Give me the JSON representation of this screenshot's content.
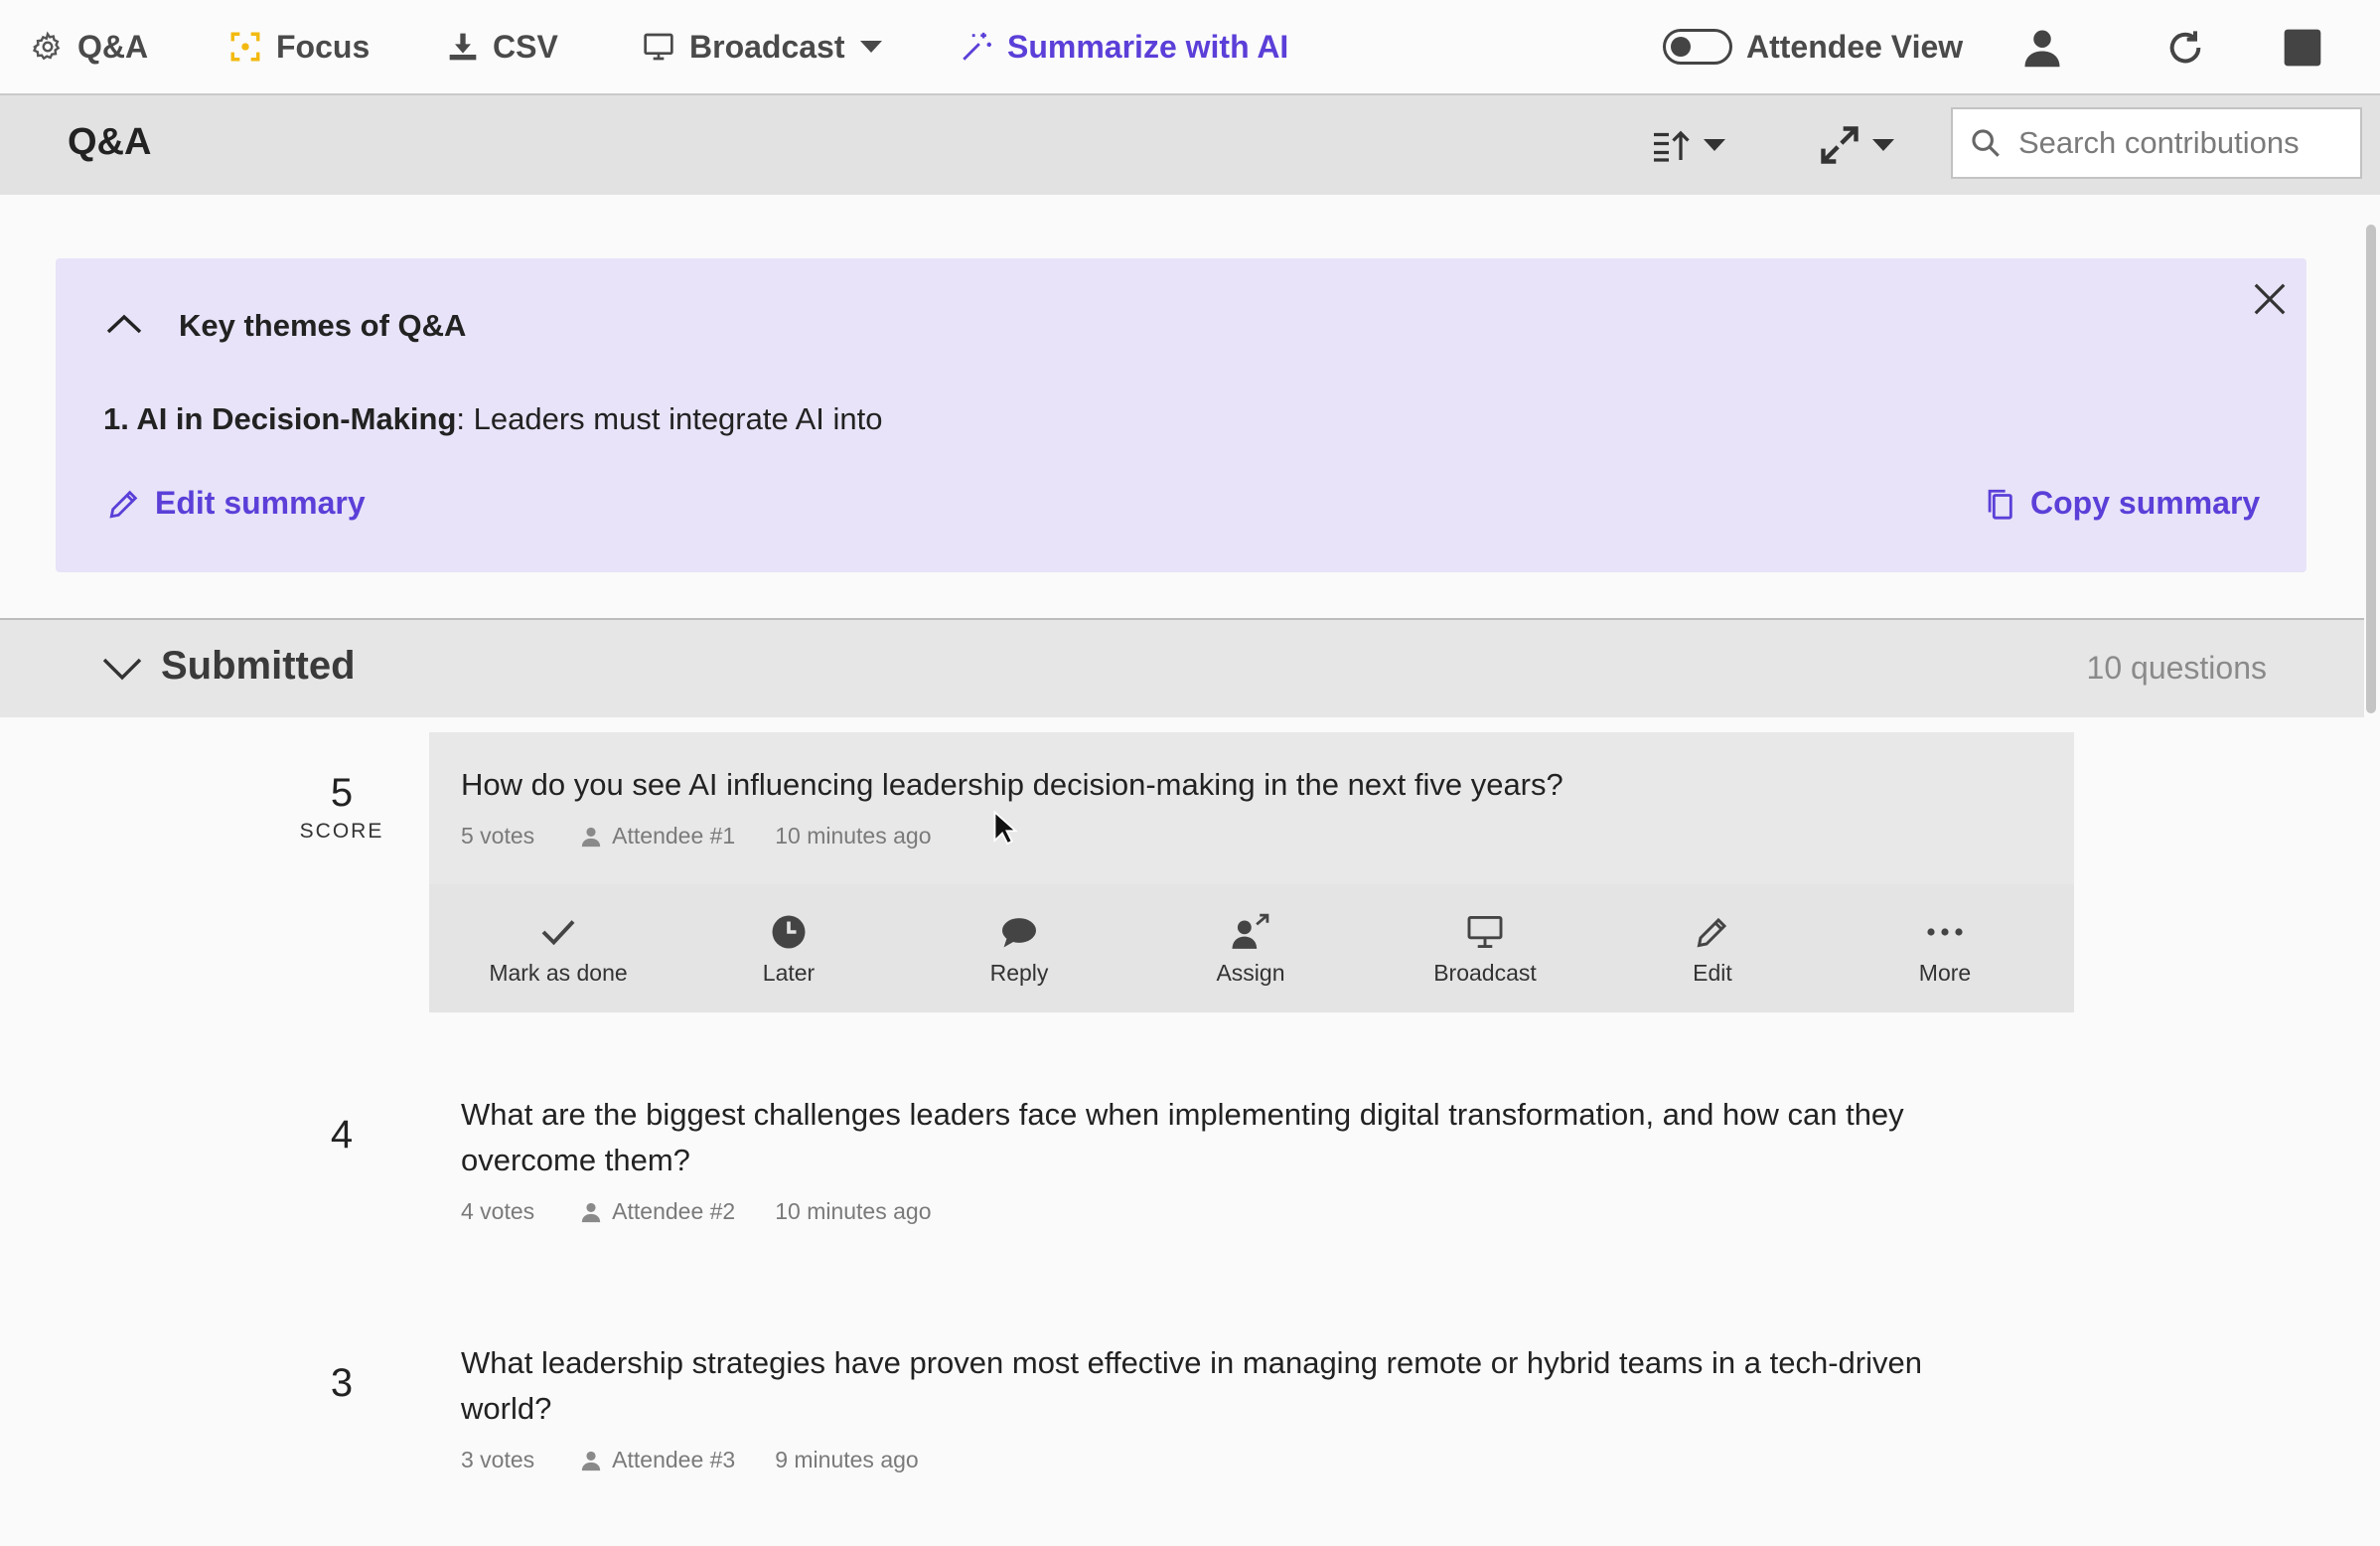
{
  "toolbar": {
    "qa_label": "Q&A",
    "focus_label": "Focus",
    "csv_label": "CSV",
    "broadcast_label": "Broadcast",
    "summarize_label": "Summarize with AI",
    "attendee_view_label": "Attendee View",
    "attendee_view_on": false
  },
  "header": {
    "title": "Q&A",
    "search_placeholder": "Search contributions"
  },
  "summary": {
    "title": "Key themes of Q&A",
    "theme_heading": "1. AI in Decision-Making",
    "theme_text": ": Leaders must integrate AI into",
    "edit_label": "Edit summary",
    "copy_label": "Copy summary"
  },
  "section": {
    "title": "Submitted",
    "count": "10 questions"
  },
  "questions": [
    {
      "score": "5",
      "score_label": "SCORE",
      "text": "How do you see AI influencing leadership decision-making in the next five years?",
      "votes": "5 votes",
      "author": "Attendee #1",
      "time": "10 minutes ago"
    },
    {
      "score": "4",
      "text": "What are the biggest challenges leaders face when implementing digital transformation, and how can they overcome them?",
      "votes": "4 votes",
      "author": "Attendee #2",
      "time": "10 minutes ago"
    },
    {
      "score": "3",
      "text": "What leadership strategies have proven most effective in managing remote or hybrid teams in a tech-driven world?",
      "votes": "3 votes",
      "author": "Attendee #3",
      "time": "9 minutes ago"
    }
  ],
  "actions": {
    "done": "Mark as done",
    "later": "Later",
    "reply": "Reply",
    "assign": "Assign",
    "broadcast": "Broadcast",
    "edit": "Edit",
    "more": "More"
  },
  "colors": {
    "accent": "#5b3fd8",
    "focus": "#f2b90f",
    "summary_bg": "#e8e3f8"
  }
}
